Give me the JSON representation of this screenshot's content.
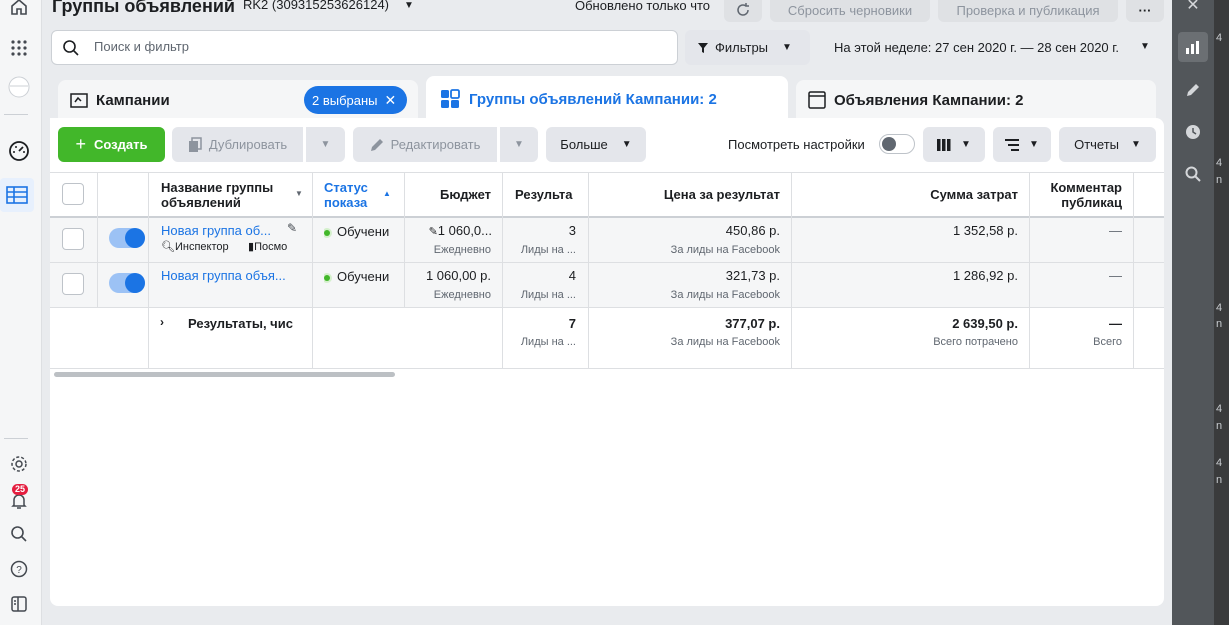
{
  "header": {
    "title": "Группы объявлений",
    "account": "RK2 (309315253626124)",
    "updated": "Обновлено только что",
    "discard_drafts": "Сбросить черновики",
    "review_publish": "Проверка и публикация",
    "more": "···"
  },
  "search": {
    "placeholder": "Поиск и фильтр"
  },
  "filters_label": "Фильтры",
  "date_range": "На этой неделе: 27 сен 2020 г. — 28 сен 2020 г.",
  "tabs": {
    "campaigns": "Кампании",
    "selected_chip": "2 выбраны",
    "adsets": "Группы объявлений Кампании: 2",
    "ads": "Объявления Кампании: 2"
  },
  "toolbar": {
    "create": "Создать",
    "duplicate": "Дублировать",
    "edit": "Редактировать",
    "more": "Больше",
    "view_settings": "Посмотреть настройки",
    "reports": "Отчеты"
  },
  "table": {
    "headers": {
      "name": "Название группы объявлений",
      "delivery": "Статус показа",
      "budget": "Бюджет",
      "results": "Результа",
      "cost_per_result": "Цена за результат",
      "amount_spent": "Сумма затрат",
      "comments": "Комментар публикац"
    },
    "rows": [
      {
        "name": "Новая группа об...",
        "inspector": "Инспектор",
        "view": "Посмо",
        "delivery": "Обучени",
        "budget": "1 060,0...",
        "budget_sub": "Ежедневно",
        "results": "3",
        "results_sub": "Лиды на ...",
        "cpr": "450,86 р.",
        "cpr_sub": "За лиды на Facebook",
        "spent": "1 352,58 р.",
        "comments": "—"
      },
      {
        "name": "Новая группа объя...",
        "delivery": "Обучени",
        "budget": "1 060,00 р.",
        "budget_sub": "Ежедневно",
        "results": "4",
        "results_sub": "Лиды на ...",
        "cpr": "321,73 р.",
        "cpr_sub": "За лиды на Facebook",
        "spent": "1 286,92 р.",
        "comments": "—"
      }
    ],
    "totals": {
      "label": "Результаты, чис",
      "results": "7",
      "results_sub": "Лиды на ...",
      "cpr": "377,07 р.",
      "cpr_sub": "За лиды на Facebook",
      "spent": "2 639,50 р.",
      "spent_sub": "Всего потрачено",
      "comments": "—",
      "comments_sub": "Всего"
    }
  },
  "left_nav": {
    "notifications_count": "25"
  },
  "right_edge_chars": [
    "4",
    "4",
    "n",
    "4",
    "n",
    "4",
    "n",
    "4",
    "n"
  ],
  "colors": {
    "accent": "#1b74e4",
    "create": "#42b72a",
    "badge": "#e41e3f"
  }
}
